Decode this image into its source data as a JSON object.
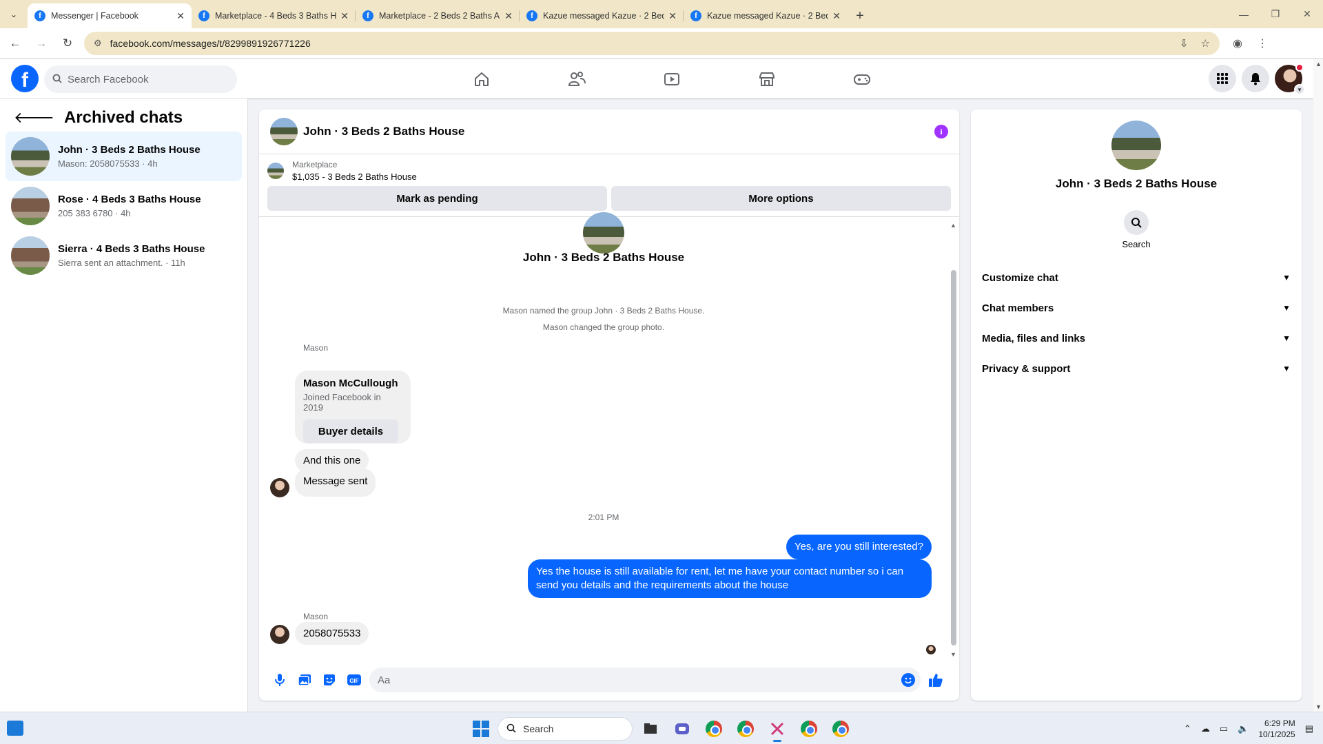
{
  "browser": {
    "tabs": [
      {
        "title": "Messenger | Facebook",
        "active": true
      },
      {
        "title": "Marketplace - 4 Beds 3 Baths H",
        "active": false
      },
      {
        "title": "Marketplace - 2 Beds 2 Baths A",
        "active": false
      },
      {
        "title": "Kazue messaged Kazue · 2 Beds",
        "active": false
      },
      {
        "title": "Kazue messaged Kazue · 2 Beds",
        "active": false
      }
    ],
    "url": "facebook.com/messages/t/8299891926771226"
  },
  "fb": {
    "search_placeholder": "Search Facebook"
  },
  "sidebar": {
    "title": "Archived chats",
    "chats": [
      {
        "name": "John · 3 Beds 2 Baths House",
        "last": "Mason: 2058075533 · 4h",
        "active": true
      },
      {
        "name": "Rose · 4 Beds 3 Baths House",
        "last": "205 383 6780 · 4h",
        "active": false
      },
      {
        "name": "Sierra · 4 Beds 3 Baths House",
        "last": "Sierra sent an attachment. · 11h",
        "active": false
      }
    ]
  },
  "chat": {
    "title": "John · 3 Beds 2 Baths House",
    "marketplace_label": "Marketplace",
    "listing": "$1,035 - 3 Beds 2 Baths House",
    "mark_pending": "Mark as pending",
    "more_options": "More options",
    "convo_name": "John · 3 Beds 2 Baths House",
    "sys1": "Mason named the group John · 3 Beds 2 Baths House.",
    "sys2": "Mason changed the group photo.",
    "sender1": "Mason",
    "card_name": "Mason McCullough",
    "card_sub": "Joined Facebook in 2019",
    "card_button": "Buyer details",
    "msg1": "And this one",
    "msg2": "Message sent",
    "time": "2:01 PM",
    "out1": "Yes, are you still interested?",
    "out2": "Yes the house is still available for rent, let me have your contact number so i can send you details and the requirements about the house",
    "sender2": "Mason",
    "msg3": "2058075533",
    "composer_placeholder": "Aa"
  },
  "info_panel": {
    "name": "John · 3 Beds 2 Baths House",
    "search_label": "Search",
    "rows": [
      "Customize chat",
      "Chat members",
      "Media, files and links",
      "Privacy & support"
    ]
  },
  "taskbar": {
    "search": "Search",
    "time": "6:29 PM",
    "date": "10/1/2025"
  },
  "colors": {
    "fb_blue": "#0866ff",
    "active_chat_bg": "#ebf5ff",
    "info_purple": "#a033ff"
  }
}
